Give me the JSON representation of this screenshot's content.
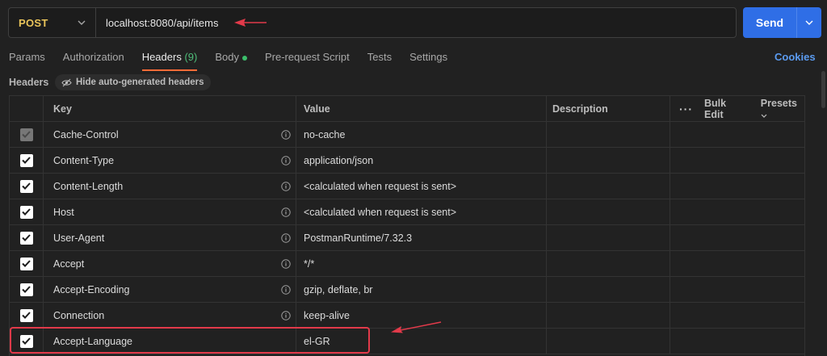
{
  "request": {
    "method": "POST",
    "url": "localhost:8080/api/items",
    "send_label": "Send"
  },
  "tabs": [
    {
      "label": "Params"
    },
    {
      "label": "Authorization"
    },
    {
      "label": "Headers",
      "count": "(9)"
    },
    {
      "label": "Body"
    },
    {
      "label": "Pre-request Script"
    },
    {
      "label": "Tests"
    },
    {
      "label": "Settings"
    }
  ],
  "cookies_label": "Cookies",
  "headers_bar": {
    "title": "Headers",
    "hide_label": "Hide auto-generated headers"
  },
  "table": {
    "columns": {
      "key": "Key",
      "value": "Value",
      "description": "Description"
    },
    "bulk_edit": "Bulk Edit",
    "presets": "Presets",
    "rows": [
      {
        "key": "Cache-Control",
        "value": "no-cache"
      },
      {
        "key": "Content-Type",
        "value": "application/json"
      },
      {
        "key": "Content-Length",
        "value": "<calculated when request is sent>"
      },
      {
        "key": "Host",
        "value": "<calculated when request is sent>"
      },
      {
        "key": "User-Agent",
        "value": "PostmanRuntime/7.32.3"
      },
      {
        "key": "Accept",
        "value": "*/*"
      },
      {
        "key": "Accept-Encoding",
        "value": "gzip, deflate, br"
      },
      {
        "key": "Connection",
        "value": "keep-alive"
      },
      {
        "key": "Accept-Language",
        "value": "el-GR"
      }
    ]
  },
  "colors": {
    "accent_tab": "#ff6c37",
    "send": "#2f6ee6",
    "method": "#e9c45a",
    "annotation": "#e23a4a"
  }
}
